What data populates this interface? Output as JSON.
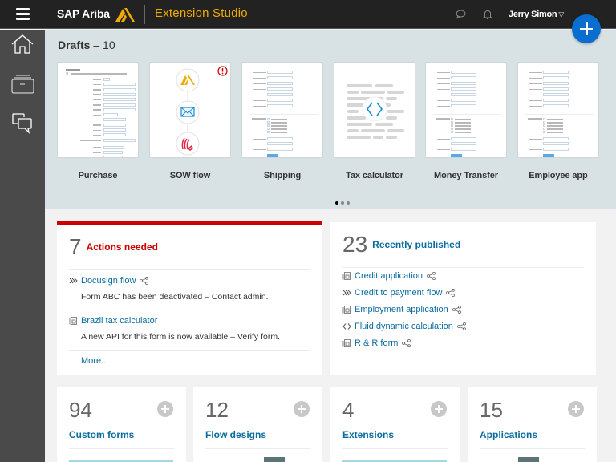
{
  "topbar": {
    "brand": "SAP Ariba",
    "product": "Extension Studio",
    "user_name": "Jerry Simon",
    "user_caret": "▽",
    "icons": [
      "menu-icon",
      "chat-icon",
      "bell-icon",
      "add-icon"
    ]
  },
  "colors": {
    "topbar_bg": "#222222",
    "sidebar_bg": "#4a4a4a",
    "accent_gold": "#f0ab00",
    "primary_blue": "#0a6ed1",
    "link_blue": "#0a6b9e",
    "alert_red": "#cc0000",
    "drafts_bg": "#d8e2e4"
  },
  "sidebar": {
    "items": [
      {
        "name": "home",
        "icon": "home-icon"
      },
      {
        "name": "inbox",
        "icon": "inbox-icon"
      },
      {
        "name": "conversations",
        "icon": "chat-bubbles-icon"
      }
    ]
  },
  "drafts": {
    "title": "Drafts",
    "separator": "–",
    "count": "10",
    "items": [
      {
        "label": "Purchase",
        "type": "form"
      },
      {
        "label": "SOW flow",
        "type": "flow",
        "warning": true
      },
      {
        "label": "Shipping",
        "type": "form"
      },
      {
        "label": "Tax calculator",
        "type": "code"
      },
      {
        "label": "Money Transfer",
        "type": "form"
      },
      {
        "label": "Employee app",
        "type": "form"
      }
    ],
    "pagination": {
      "pages": 3,
      "current": 1
    }
  },
  "actions": {
    "count": "7",
    "title": "Actions needed",
    "items": [
      {
        "icon": "flow-icon",
        "link": "Docusign flow",
        "shared": true,
        "message": "Form ABC has been deactivated – Contact admin."
      },
      {
        "icon": "form-icon",
        "link": "Brazil tax calculator",
        "shared": false,
        "message": "A new API for this form is now available – Verify form."
      }
    ],
    "more": "More..."
  },
  "published": {
    "count": "23",
    "title": "Recently published",
    "items": [
      {
        "icon": "form-icon",
        "label": "Credit application",
        "shared": true
      },
      {
        "icon": "flow-icon",
        "label": "Credit to payment flow",
        "shared": true
      },
      {
        "icon": "form-icon",
        "label": "Employment application",
        "shared": true
      },
      {
        "icon": "code-icon",
        "label": "Fluid dynamic calculation",
        "shared": true
      },
      {
        "icon": "form-icon",
        "label": "R & R form",
        "shared": true
      }
    ]
  },
  "stats": [
    {
      "count": "94",
      "label": "Custom forms"
    },
    {
      "count": "12",
      "label": "Flow designs"
    },
    {
      "count": "4",
      "label": "Extensions"
    },
    {
      "count": "15",
      "label": "Applications"
    }
  ]
}
